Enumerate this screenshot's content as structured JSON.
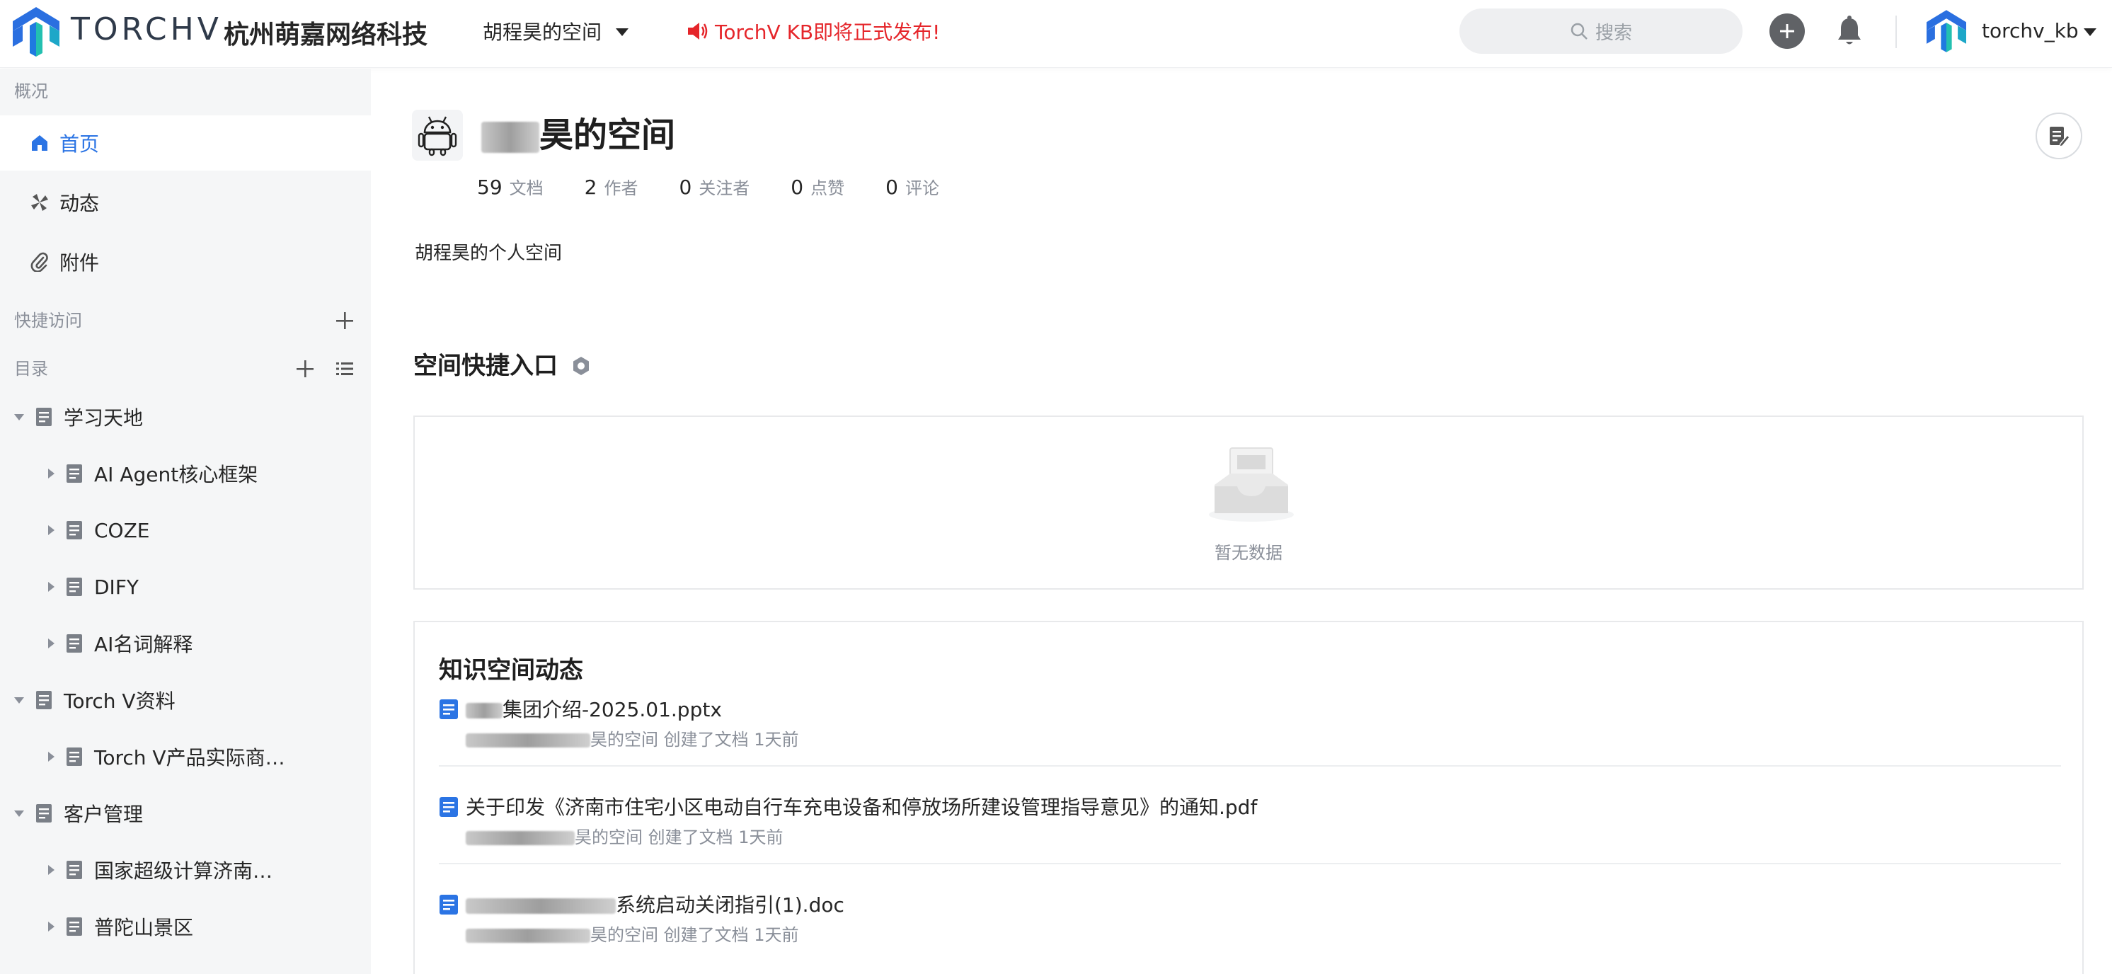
{
  "header": {
    "brand_word": "TORCHV",
    "brand_company": "杭州萌嘉网络科技",
    "space_switch": "胡程昊的空间",
    "announcement": "TorchV KB即将正式发布!",
    "search_placeholder": "搜索",
    "username": "torchv_kb"
  },
  "sidebar": {
    "overview_label": "概况",
    "nav": [
      {
        "label": "首页",
        "icon": "home-icon",
        "active": true
      },
      {
        "label": "动态",
        "icon": "activity-icon",
        "active": false
      },
      {
        "label": "附件",
        "icon": "paperclip-icon",
        "active": false
      }
    ],
    "quick_access_label": "快捷访问",
    "catalog_label": "目录",
    "tree": [
      {
        "label": "学习天地",
        "level": 0,
        "expanded": true
      },
      {
        "label": "AI Agent核心框架",
        "level": 1,
        "expanded": false
      },
      {
        "label": "COZE",
        "level": 1,
        "expanded": false
      },
      {
        "label": "DIFY",
        "level": 1,
        "expanded": false
      },
      {
        "label": "AI名词解释",
        "level": 1,
        "expanded": false
      },
      {
        "label": "Torch V资料",
        "level": 0,
        "expanded": true
      },
      {
        "label": "Torch V产品实际商…",
        "level": 1,
        "expanded": false
      },
      {
        "label": "客户管理",
        "level": 0,
        "expanded": true
      },
      {
        "label": "国家超级计算济南…",
        "level": 1,
        "expanded": false
      },
      {
        "label": "普陀山景区",
        "level": 1,
        "expanded": false
      }
    ]
  },
  "space": {
    "title_visible": "昊的空间",
    "stats": [
      {
        "num": "59",
        "unit": "文档"
      },
      {
        "num": "2",
        "unit": "作者"
      },
      {
        "num": "0",
        "unit": "关注者"
      },
      {
        "num": "0",
        "unit": "点赞"
      },
      {
        "num": "0",
        "unit": "评论"
      }
    ],
    "description": "胡程昊的个人空间"
  },
  "quick_entry": {
    "title": "空间快捷入口",
    "empty_text": "暂无数据"
  },
  "feed": {
    "title": "知识空间动态",
    "items": [
      {
        "name": "集团介绍-2025.01.pptx",
        "meta": "昊的空间 创建了文档 1天前"
      },
      {
        "name": "关于印发《济南市住宅小区电动自行车充电设备和停放场所建设管理指导意见》的通知.pdf",
        "meta": "昊的空间 创建了文档 1天前"
      },
      {
        "name": "系统启动关闭指引(1).doc",
        "meta": "昊的空间 创建了文档 1天前"
      }
    ]
  },
  "colors": {
    "accent": "#2b74e4",
    "announce": "#e5252a",
    "sidebar_bg": "#f5f6f7",
    "logo_blue": "#1f7ae0",
    "logo_teal": "#23c0b0"
  }
}
